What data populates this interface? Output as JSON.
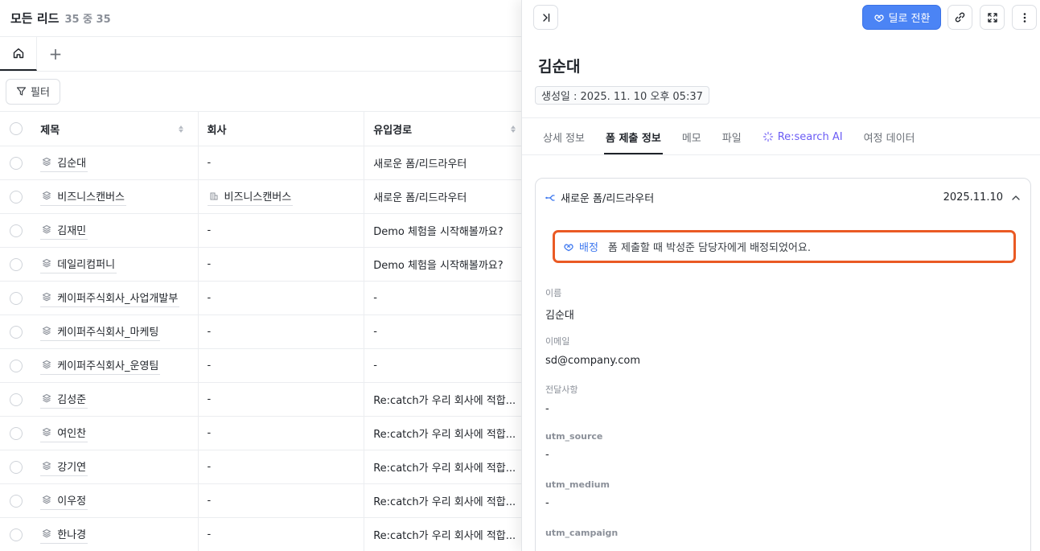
{
  "list": {
    "title": "모든 리드",
    "count": "35 중 35",
    "filter_label": "필터",
    "columns": [
      "제목",
      "회사",
      "유입경로"
    ],
    "rows": [
      {
        "name": "김순대",
        "company": "-",
        "source": "새로운 폼/리드라우터"
      },
      {
        "name": "비즈니스캔버스",
        "company": "비즈니스캔버스",
        "source": "새로운 폼/리드라우터"
      },
      {
        "name": "김재민",
        "company": "-",
        "source": "Demo 체험을 시작해볼까요?"
      },
      {
        "name": "데일리컴퍼니",
        "company": "-",
        "source": "Demo 체험을 시작해볼까요?"
      },
      {
        "name": "케이퍼주식회사_사업개발부",
        "company": "-",
        "source": "-"
      },
      {
        "name": "케이퍼주식회사_마케팅",
        "company": "-",
        "source": "-"
      },
      {
        "name": "케이퍼주식회사_운영팀",
        "company": "-",
        "source": "-"
      },
      {
        "name": "김성준",
        "company": "-",
        "source": "Re:catch가 우리 회사에 적합..."
      },
      {
        "name": "여인찬",
        "company": "-",
        "source": "Re:catch가 우리 회사에 적합..."
      },
      {
        "name": "강기연",
        "company": "-",
        "source": "Re:catch가 우리 회사에 적합..."
      },
      {
        "name": "이우정",
        "company": "-",
        "source": "Re:catch가 우리 회사에 적합..."
      },
      {
        "name": "한나경",
        "company": "-",
        "source": "Re:catch가 우리 회사에 적합..."
      }
    ]
  },
  "panel": {
    "deal_button": "딜로 전환",
    "name": "김순대",
    "created": "생성일 : 2025. 11. 10 오후 05:37",
    "tabs": [
      "상세 정보",
      "폼 제출 정보",
      "메모",
      "파일",
      "Re:search AI",
      "여정 데이터"
    ],
    "active_tab": "폼 제출 정보",
    "card": {
      "route": "새로운 폼/리드라우터",
      "date": "2025.11.10",
      "assign_tag": "배정",
      "assign_msg": "폼 제출할 때 박성준 담당자에게 배정되었어요.",
      "fields": [
        {
          "label": "이름",
          "value": "김순대"
        },
        {
          "label": "이메일",
          "value": "sd@company.com"
        },
        {
          "label": "전달사항",
          "value": "-"
        },
        {
          "label": "utm_source",
          "value": "-"
        },
        {
          "label": "utm_medium",
          "value": "-"
        },
        {
          "label": "utm_campaign",
          "value": ""
        }
      ]
    }
  },
  "colors": {
    "accent": "#4b84f5",
    "highlight": "#ea5a24",
    "ai": "#6b5cf5"
  }
}
